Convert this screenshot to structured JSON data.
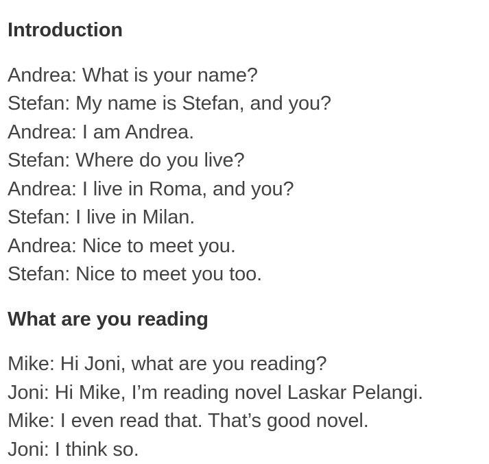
{
  "document": {
    "background_color": "#ffffff",
    "heading_color": "#333333",
    "body_color": "#434343",
    "sections": [
      {
        "heading": "Introduction",
        "lines": [
          "Andrea: What is your name?",
          "Stefan: My name is Stefan, and you?",
          "Andrea: I am Andrea.",
          "Stefan: Where do you live?",
          "Andrea: I live in Roma, and you?",
          "Stefan: I live in Milan.",
          "Andrea: Nice to meet you.",
          "Stefan: Nice to meet you too."
        ]
      },
      {
        "heading": "What are you reading",
        "lines": [
          "Mike: Hi Joni, what are you reading?",
          "Joni: Hi Mike, I’m reading novel Laskar Pelangi.",
          "Mike: I even read that. That’s good novel.",
          "Joni: I think so."
        ]
      }
    ]
  }
}
